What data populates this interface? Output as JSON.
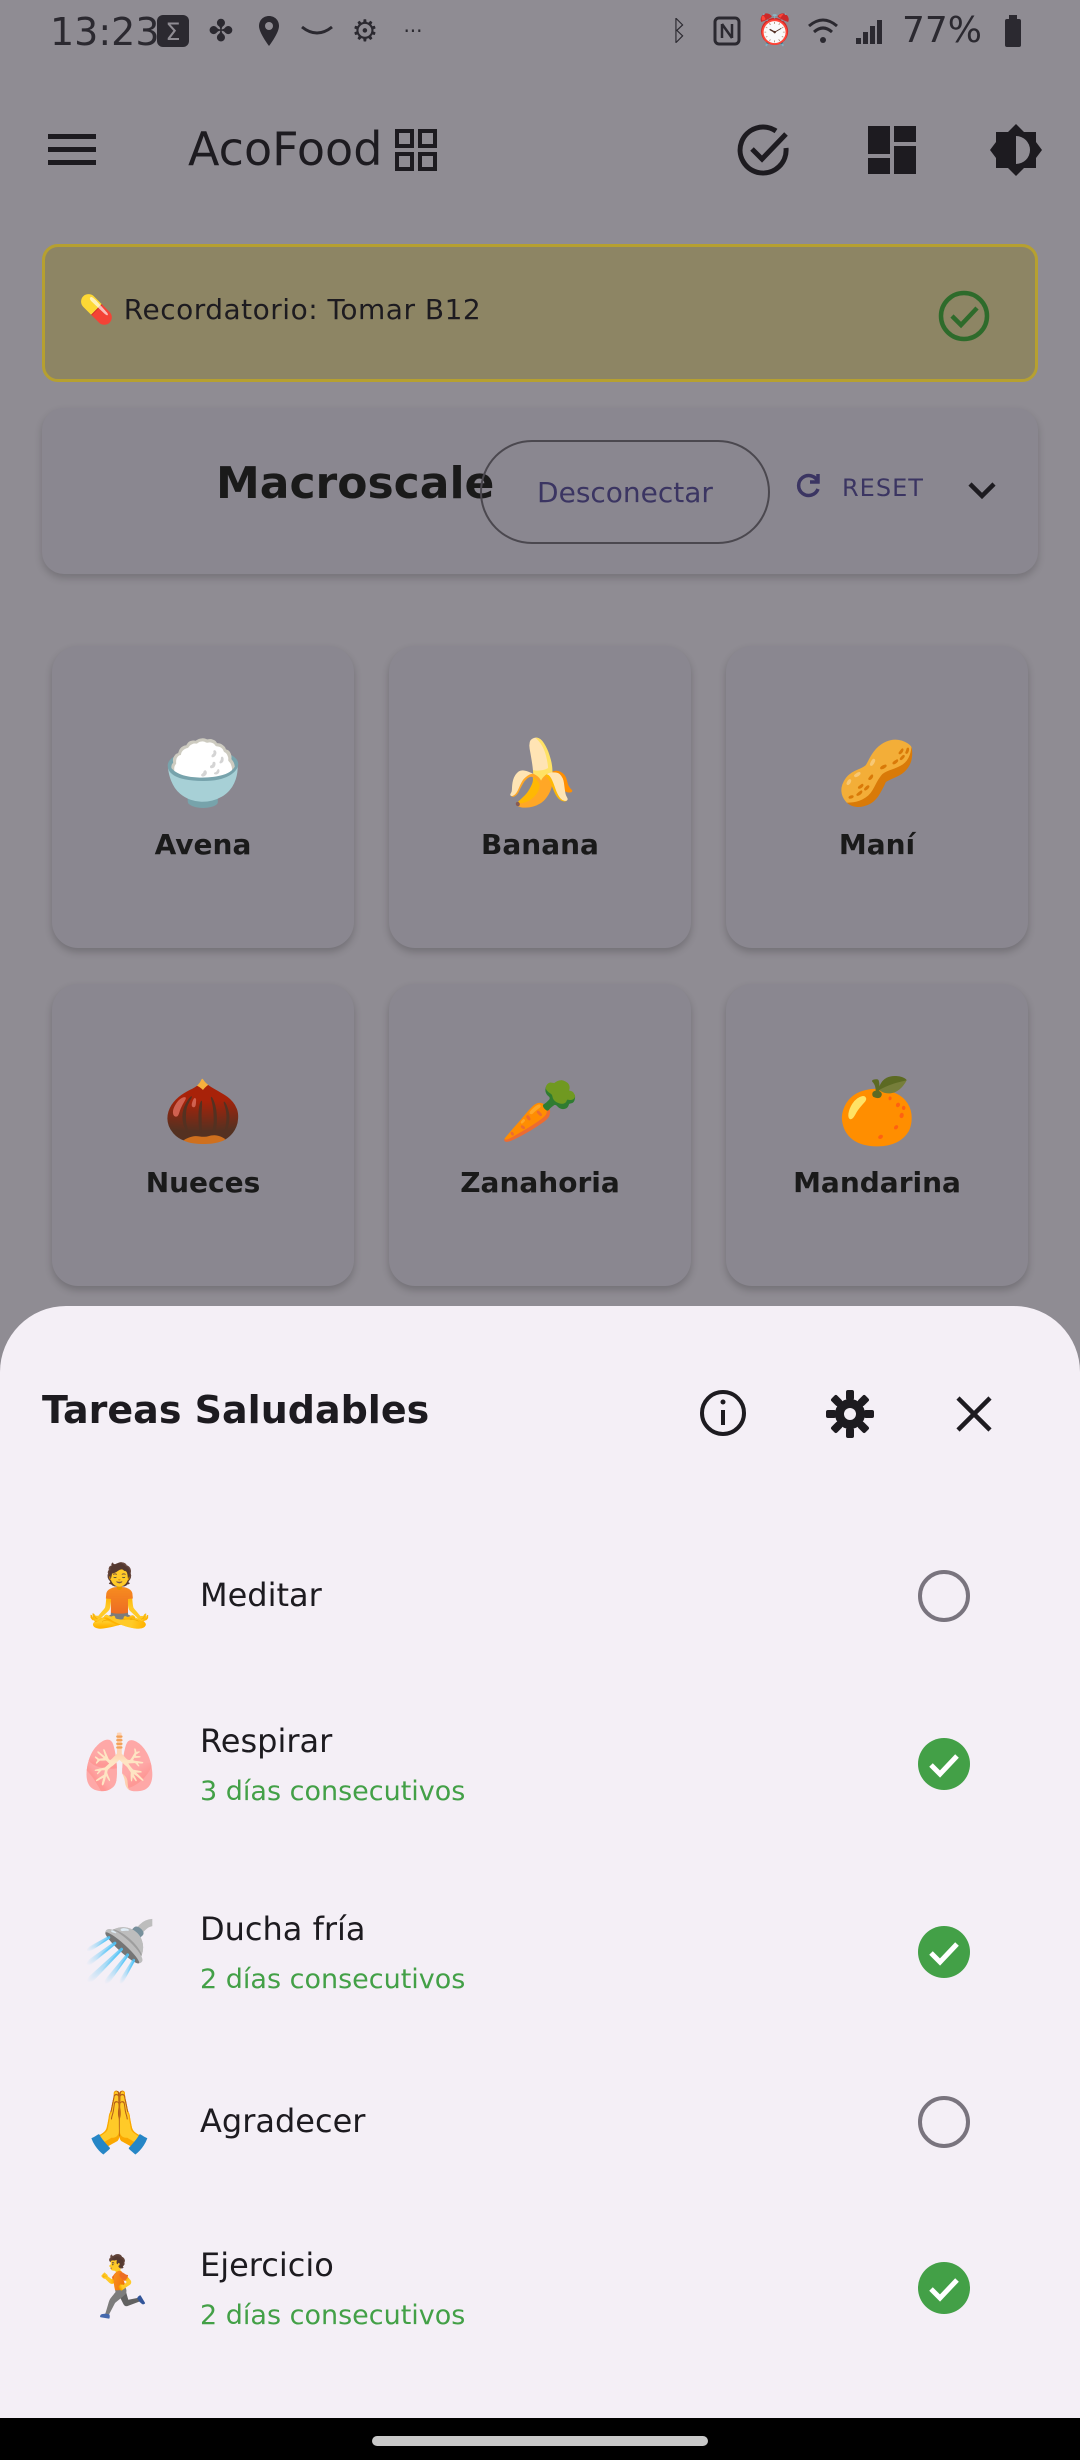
{
  "status_bar": {
    "time": "13:23",
    "battery_percent": "77%"
  },
  "app_bar": {
    "title": "AcoFood"
  },
  "reminder": {
    "emoji": "💊",
    "text": "Recordatorio: Tomar B12"
  },
  "scale": {
    "title": "Macroscale",
    "disconnect_label": "Desconectar",
    "reset_label": "RESET"
  },
  "foods": [
    {
      "emoji": "🍚",
      "label": "Avena"
    },
    {
      "emoji": "🍌",
      "label": "Banana"
    },
    {
      "emoji": "🥜",
      "label": "Maní"
    },
    {
      "emoji": "🌰",
      "label": "Nueces"
    },
    {
      "emoji": "🥕",
      "label": "Zanahoria"
    },
    {
      "emoji": "🍊",
      "label": "Mandarina"
    }
  ],
  "sheet": {
    "title": "Tareas Saludables",
    "tasks": [
      {
        "emoji": "🧘",
        "label": "Meditar",
        "streak": "",
        "done": false
      },
      {
        "emoji": "🫁",
        "label": "Respirar",
        "streak": "3 días consecutivos",
        "done": true
      },
      {
        "emoji": "🚿",
        "label": "Ducha fría",
        "streak": "2 días consecutivos",
        "done": true
      },
      {
        "emoji": "🙏",
        "label": "Agradecer",
        "streak": "",
        "done": false
      },
      {
        "emoji": "🏃",
        "label": "Ejercicio",
        "streak": "2 días consecutivos",
        "done": true
      }
    ]
  },
  "colors": {
    "accent_green": "#43a047",
    "scrim": "#8f8c93",
    "sheet_bg": "#f4eff6"
  }
}
